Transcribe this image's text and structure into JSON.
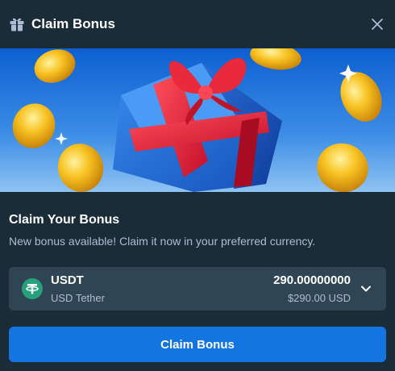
{
  "modal": {
    "title": "Claim Bonus",
    "title_icon": "gift-icon",
    "close_icon": "close-icon"
  },
  "banner": {
    "illustration": "gift-box-with-gold-coins"
  },
  "content": {
    "heading": "Claim Your Bonus",
    "description": "New bonus available! Claim it now in your preferred currency."
  },
  "currency": {
    "code": "USDT",
    "name": "USD Tether",
    "amount": "290.00000000",
    "fiat_value": "$290.00 USD",
    "icon": "tether-icon",
    "dropdown_icon": "chevron-down-icon"
  },
  "claim_button": {
    "label": "Claim Bonus"
  },
  "colors": {
    "background": "#1a2c38",
    "select_bg": "#2f4553",
    "secondary_text": "#b1bad3",
    "primary_button": "#1475e1",
    "tether_green": "#26a17b"
  }
}
